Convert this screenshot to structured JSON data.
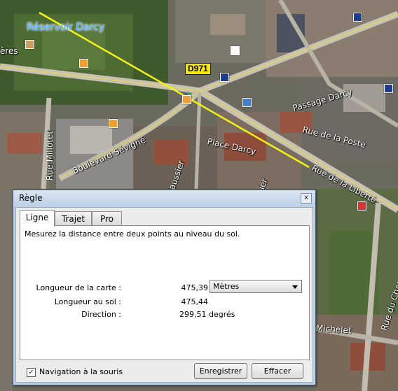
{
  "map": {
    "labels": {
      "reservoir": "Réservoir Darcy",
      "eres": "ères",
      "passage_darcy": "Passage Darcy",
      "rue_poste": "Rue de la Poste",
      "place_darcy": "Place Darcy",
      "boulevard_sevigne": "Boulevard Sévigné",
      "rue_millotet": "Rue Millotet",
      "rue_liberte": "Rue de la Liberté",
      "rue_chapeau_rouge": "Rue du Chapeau Rouge",
      "michelet": "Michelet",
      "aussier": "aussier",
      "ruelle_ier": "ier"
    },
    "road_shield": "D971",
    "ruler_line_color": "#f2f21a",
    "icons": [
      "photo-icon",
      "museum-icon",
      "poi-icon",
      "start-pin-icon"
    ]
  },
  "dialog": {
    "title": "Règle",
    "close": "x",
    "tabs": [
      "Ligne",
      "Trajet",
      "Pro"
    ],
    "active_tab": "Ligne",
    "description": "Mesurez la distance entre deux points au niveau du sol.",
    "map_length_label": "Longueur de la carte :",
    "map_length_value": "475,39",
    "unit": "Mètres",
    "ground_length_label": "Longueur au sol :",
    "ground_length_value": "475,44",
    "direction_label": "Direction :",
    "direction_value": "299,51 degrés",
    "mouse_nav_label": "Navigation à la souris",
    "mouse_nav_checked": "✓",
    "save_button": "Enregistrer",
    "clear_button": "Effacer"
  }
}
